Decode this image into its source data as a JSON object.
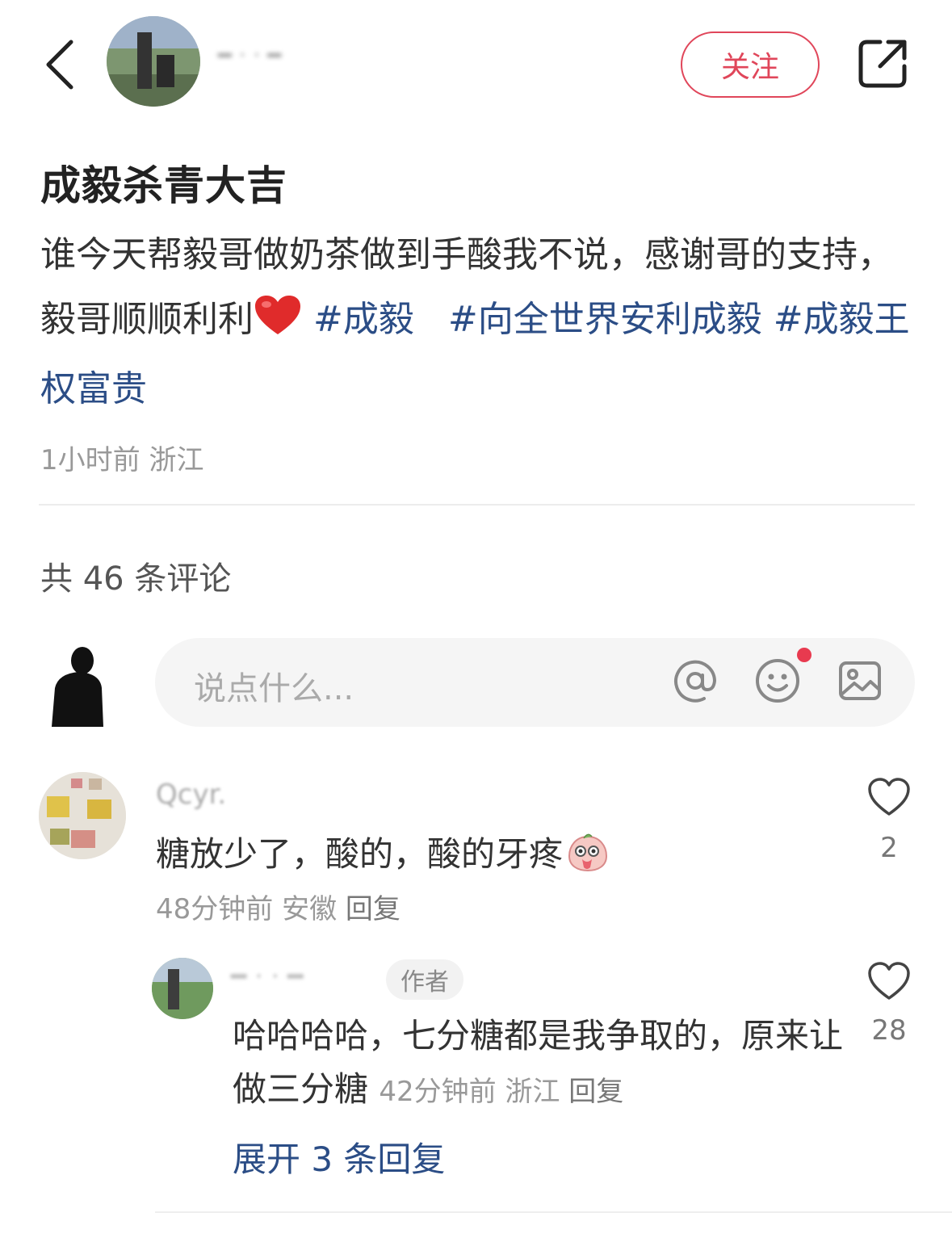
{
  "header": {
    "username": "━ ‧ ‧ ━",
    "follow_label": "关注"
  },
  "post": {
    "title": "成毅杀青大吉",
    "body_text": "谁今天帮毅哥做奶茶做到手酸我不说，感谢哥的支持，毅哥顺顺利利",
    "hashtags": [
      "#成毅",
      "#向全世界安利成毅",
      "#成毅王权富贵"
    ],
    "time": "1小时前",
    "location": "浙江"
  },
  "comments_count_label": "共 46 条评论",
  "input": {
    "placeholder": "说点什么..."
  },
  "comments": [
    {
      "username": "Qcyr.",
      "text": "糖放少了，酸的，酸的牙疼",
      "time": "48分钟前",
      "location": "安徽",
      "reply_label": "回复",
      "likes": "2"
    },
    {
      "username": "━ ‧ ‧ ━",
      "badge": "作者",
      "text": "哈哈哈哈，七分糖都是我争取的，原来让做三分糖",
      "time": "42分钟前",
      "location": "浙江",
      "reply_label": "回复",
      "likes": "28"
    }
  ],
  "expand_label": "展开 3 条回复",
  "colors": {
    "accent": "#e0465a",
    "link": "#2b4d86",
    "dot": "#e83a4f"
  }
}
